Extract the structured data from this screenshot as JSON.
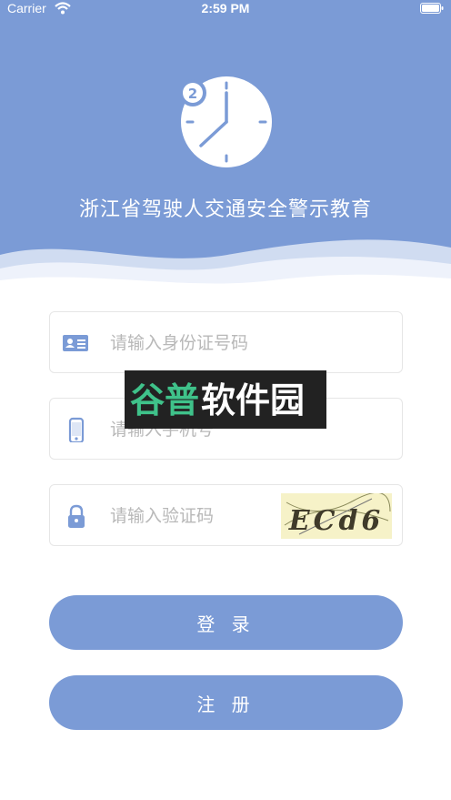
{
  "status_bar": {
    "carrier": "Carrier",
    "time": "2:59 PM"
  },
  "header": {
    "title": "浙江省驾驶人交通安全警示教育",
    "clock_badge": "2",
    "icon": "clock-icon"
  },
  "form": {
    "id_field": {
      "placeholder": "请输入身份证号码",
      "value": "",
      "icon": "id-card-icon"
    },
    "phone_field": {
      "placeholder": "请输入手机号",
      "value": "",
      "icon": "phone-icon"
    },
    "code_field": {
      "placeholder": "请输入验证码",
      "value": "",
      "icon": "lock-icon"
    },
    "captcha_text": "ECd6"
  },
  "buttons": {
    "login": "登 录",
    "register": "注 册"
  },
  "watermark": {
    "text": "谷普软件园"
  },
  "colors": {
    "primary": "#7b9bd6",
    "wave_light": "#c7d4ee",
    "field_border": "#e6e6e6",
    "placeholder": "#b8b8b8"
  }
}
